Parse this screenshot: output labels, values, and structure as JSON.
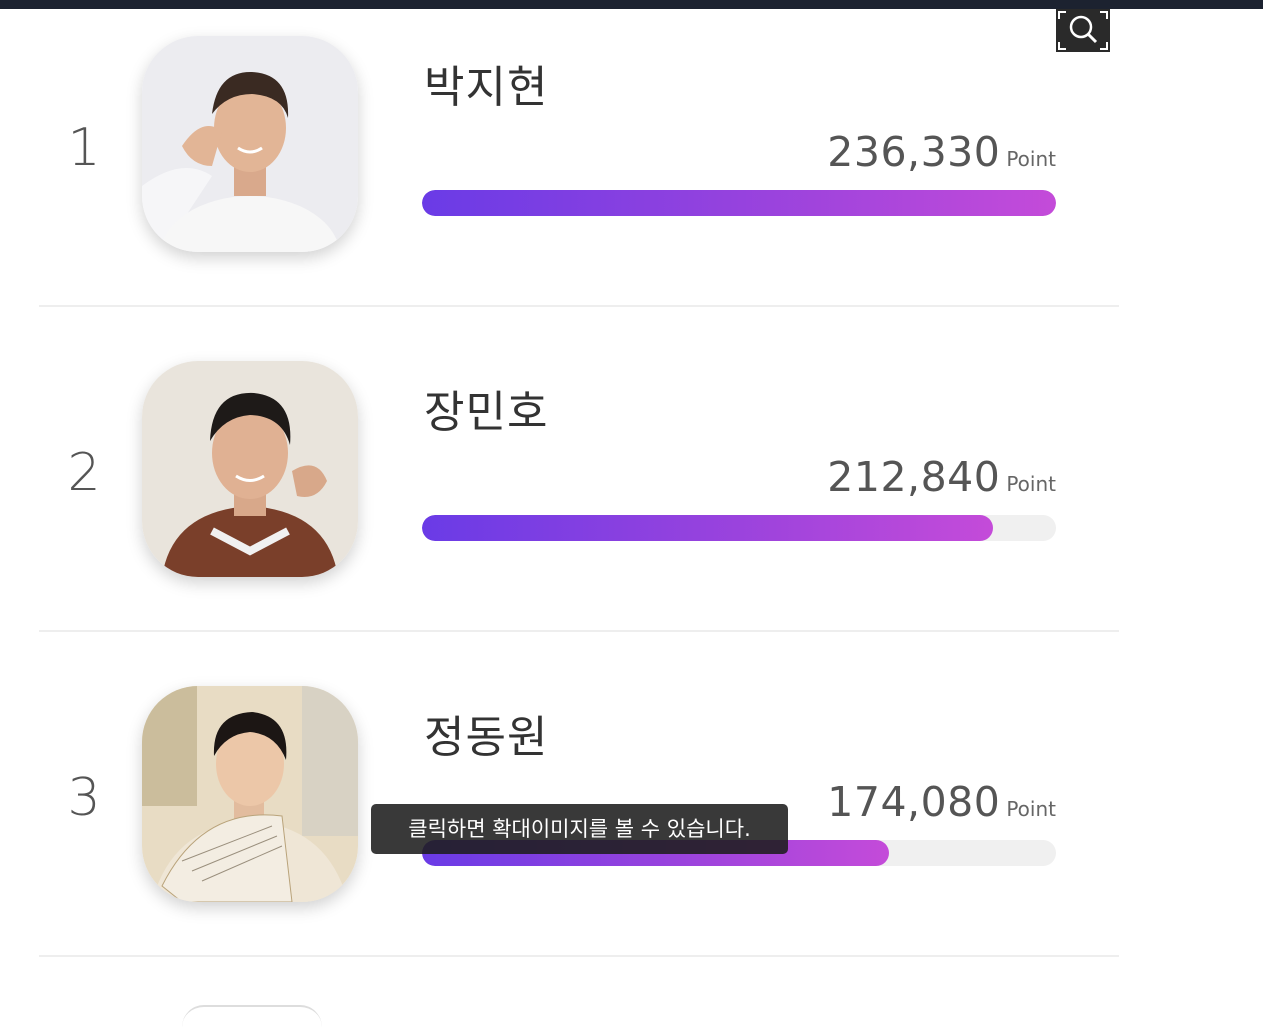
{
  "zoom_button": {
    "icon": "zoom-search-icon"
  },
  "rankings": [
    {
      "rank": "1",
      "name": "박지현",
      "points": "236,330",
      "unit": "Point",
      "fill": 1.0,
      "avatar": "portrait-1"
    },
    {
      "rank": "2",
      "name": "장민호",
      "points": "212,840",
      "unit": "Point",
      "fill": 0.9,
      "avatar": "portrait-2"
    },
    {
      "rank": "3",
      "name": "정동원",
      "points": "174,080",
      "unit": "Point",
      "fill": 0.737,
      "avatar": "portrait-3"
    }
  ],
  "tooltip": {
    "text": "클릭하면 확대이미지를 볼 수 있습니다."
  },
  "colors": {
    "bar_start": "#6a3be6",
    "bar_end": "#c44bd9",
    "track": "#f0f0f0",
    "topbar": "#1c2230"
  }
}
